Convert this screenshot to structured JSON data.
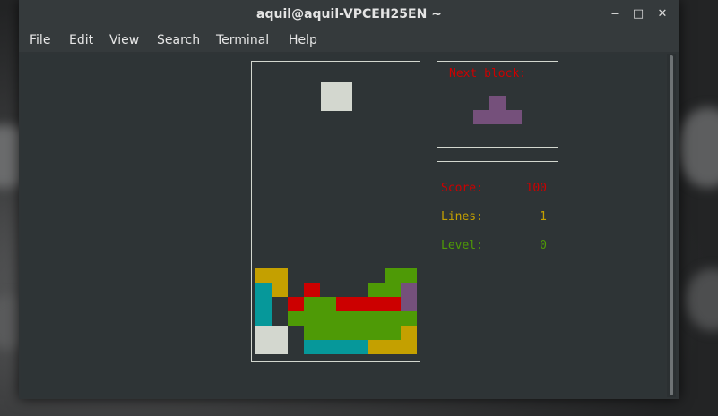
{
  "window": {
    "title": "aquil@aquil-VPCEH25EN ~",
    "controls": {
      "minimize": "‒",
      "maximize": "□",
      "close": "✕"
    }
  },
  "menu": [
    "File",
    "Edit",
    "View",
    "Search",
    "Terminal",
    "Help"
  ],
  "game": {
    "next_block_label": "Next block:",
    "score_label": "Score:",
    "score_value": "100",
    "lines_label": "Lines:",
    "lines_value": "1",
    "level_label": "Level:",
    "level_value": "0"
  },
  "colors": {
    "red": "#cc0000",
    "yellow": "#c4a000",
    "green": "#4e9a06",
    "teal": "#06989a",
    "purple": "#75507b",
    "white": "#d3d7cf",
    "terminal_bg": "#2e3436"
  }
}
